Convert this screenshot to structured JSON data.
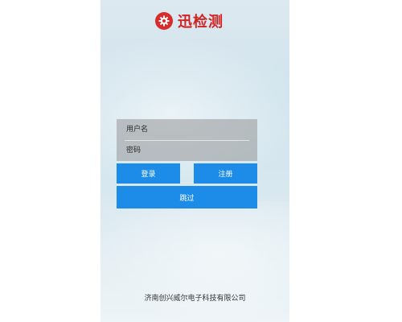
{
  "header": {
    "app_title": "迅检测",
    "logo_icon": "gear-icon",
    "logo_color": "#d82b2b"
  },
  "login_form": {
    "username_placeholder": "用户名",
    "password_placeholder": "密码",
    "login_label": "登录",
    "register_label": "注册",
    "skip_label": "跳过",
    "button_color": "#1d8ce8"
  },
  "footer": {
    "company": "济南创兴威尔电子科技有限公司"
  }
}
